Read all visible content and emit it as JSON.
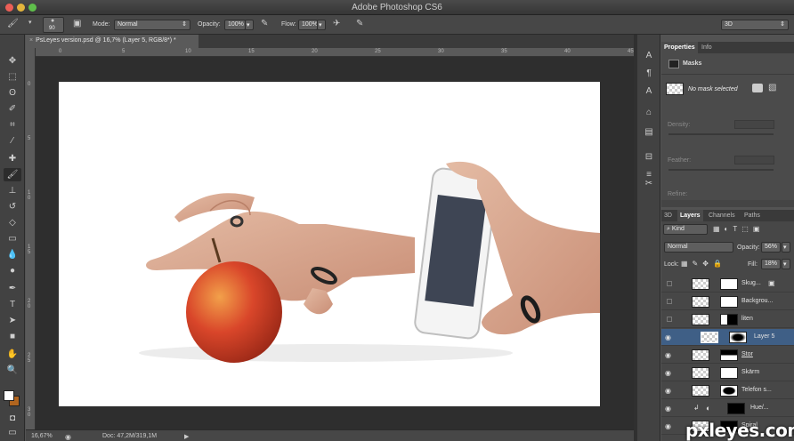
{
  "app": {
    "title": "Adobe Photoshop CS6"
  },
  "options": {
    "brush_size": "90",
    "mode_label": "Mode:",
    "mode_value": "Normal",
    "opacity_label": "Opacity:",
    "opacity_value": "100%",
    "flow_label": "Flow:",
    "flow_value": "100%",
    "workspace": "3D"
  },
  "document": {
    "tab_label": "PsLeyes version.psd @ 16,7% (Layer 5, RGB/8*) *"
  },
  "rulers": {
    "h": [
      "0",
      "5",
      "10",
      "15",
      "20",
      "25",
      "30",
      "35",
      "40",
      "45"
    ],
    "v": [
      "0",
      "5",
      "1 0",
      "1 5",
      "2 0",
      "2 5",
      "3 0"
    ]
  },
  "status": {
    "zoom": "16,67%",
    "doc": "Doc: 47,2M/319,1M"
  },
  "properties": {
    "tabs": [
      "Properties",
      "Info"
    ],
    "section": "Masks",
    "mask_status": "No mask selected",
    "density_label": "Density:",
    "feather_label": "Feather:",
    "refine_label": "Refine:"
  },
  "layers_panel": {
    "tabs": [
      "3D",
      "Layers",
      "Channels",
      "Paths"
    ],
    "kind": "Kind",
    "blend_mode": "Normal",
    "opacity_label": "Opacity:",
    "opacity_value": "56%",
    "lock_label": "Lock:",
    "fill_label": "Fill:",
    "fill_value": "18%",
    "layers": [
      {
        "name": "Skug..."
      },
      {
        "name": "Backgrou..."
      },
      {
        "name": "liten"
      },
      {
        "name": "Layer 5"
      },
      {
        "name": "Stor"
      },
      {
        "name": "Skärm"
      },
      {
        "name": "Telefon s..."
      },
      {
        "name": "Hue/..."
      },
      {
        "name": "Spiral"
      }
    ]
  },
  "watermark": "pxleyes.com",
  "colors": {
    "accent": "#3c6f9e",
    "selected_layer": "#3f5f86"
  }
}
